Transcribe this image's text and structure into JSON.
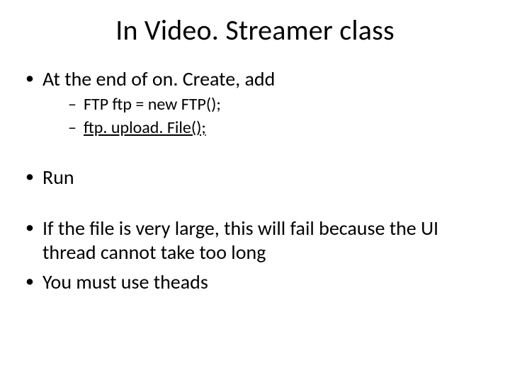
{
  "slide": {
    "title": "In Video. Streamer class",
    "bullets": {
      "b1": {
        "text": "At the end of on. Create, add",
        "sub": {
          "s1": "FTP ftp = new FTP();",
          "s2": "ftp. upload. File();"
        }
      },
      "b2": {
        "text": "Run"
      },
      "b3": {
        "text": "If the file is very large, this will fail because the UI thread cannot take too long"
      },
      "b4": {
        "text": "You must use theads"
      }
    }
  }
}
